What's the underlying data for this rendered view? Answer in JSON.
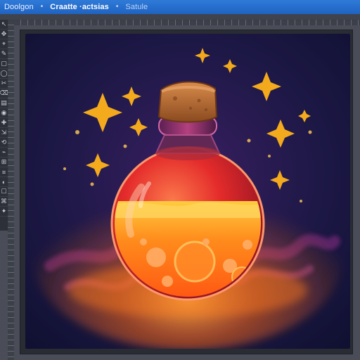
{
  "window": {
    "breadcrumbs": [
      {
        "label": "Doolgon",
        "state": "normal"
      },
      {
        "label": "Craatte ·actsias",
        "state": "active"
      },
      {
        "label": "Satule",
        "state": "dim"
      }
    ]
  },
  "toolbar": {
    "tools": [
      "↖",
      "✥",
      "⌖",
      "✎",
      "▢",
      "◯",
      "✂",
      "⌫",
      "▤",
      "◉",
      "✚",
      "⇲",
      "⟲",
      "⌁",
      "⊞",
      "≡",
      "◐",
      "☐",
      "⌘",
      "✦"
    ]
  },
  "artwork": {
    "subject": "Glowing orange potion bottle with cork and sparkles",
    "colors": {
      "background_top": "#14133a",
      "background_bottom": "#2b1a52",
      "liquid": "#ff6a1a",
      "liquid_light": "#ffb33b",
      "glass": "#ff3a24",
      "cork": "#b86a2e",
      "neck": "#7a2b6d",
      "sparkle": "#ffb21b",
      "smoke": "#7b2a7a"
    }
  }
}
